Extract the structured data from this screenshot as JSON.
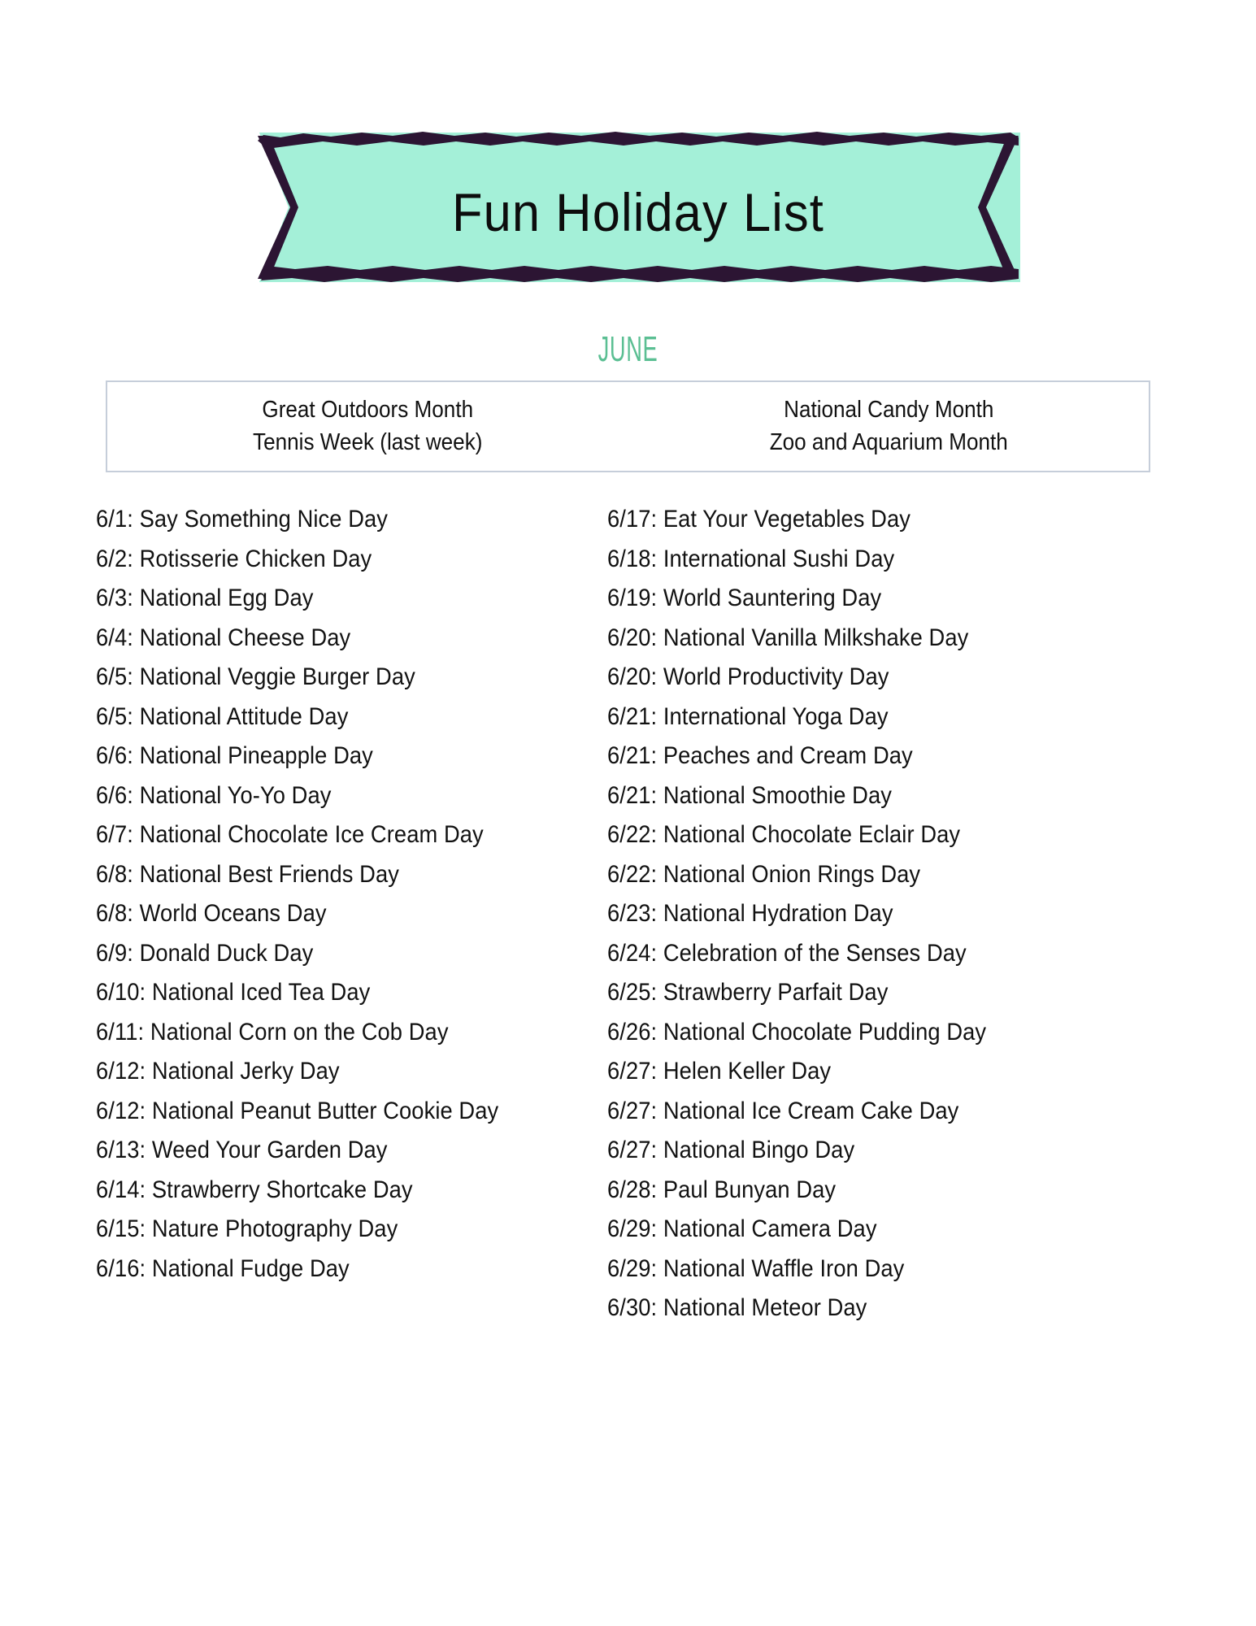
{
  "colors": {
    "banner_fill": "#a4f0d8",
    "banner_outline": "#2c1533",
    "month_accent": "#5bbf93",
    "box_border": "#c6ceda",
    "text": "#121212",
    "page_background": "#ffffff"
  },
  "header": {
    "title": "Fun Holiday List",
    "month": "JUNE"
  },
  "observances": {
    "left": [
      "Great Outdoors Month",
      "Tennis Week (last week)"
    ],
    "right": [
      "National Candy Month",
      "Zoo and Aquarium Month"
    ]
  },
  "holidays": {
    "left_column": [
      "6/1: Say Something Nice Day",
      "6/2: Rotisserie Chicken Day",
      "6/3: National Egg Day",
      "6/4: National Cheese Day",
      "6/5: National Veggie Burger Day",
      "6/5: National Attitude Day",
      "6/6: National Pineapple Day",
      "6/6: National Yo-Yo Day",
      "6/7: National Chocolate Ice Cream Day",
      "6/8: National Best Friends Day",
      "6/8: World Oceans Day",
      "6/9: Donald Duck Day",
      "6/10: National Iced Tea Day",
      "6/11: National Corn on the Cob Day",
      "6/12: National Jerky Day",
      "6/12: National Peanut Butter Cookie Day",
      "6/13: Weed Your Garden Day",
      "6/14: Strawberry Shortcake Day",
      "6/15: Nature Photography Day",
      "6/16: National Fudge Day"
    ],
    "right_column": [
      "6/17: Eat Your Vegetables Day",
      "6/18: International Sushi Day",
      "6/19: World Sauntering Day",
      "6/20: National Vanilla Milkshake Day",
      "6/20: World Productivity Day",
      "6/21: International Yoga Day",
      "6/21: Peaches and Cream Day",
      "6/21: National Smoothie Day",
      "6/22: National Chocolate Eclair Day",
      "6/22: National Onion Rings Day",
      "6/23: National Hydration Day",
      "6/24: Celebration of the Senses Day",
      "6/25: Strawberry Parfait Day",
      "6/26: National Chocolate Pudding Day",
      "6/27: Helen Keller Day",
      "6/27: National Ice Cream Cake Day",
      "6/27: National Bingo Day",
      "6/28: Paul Bunyan Day",
      "6/29: National Camera Day",
      "6/29: National Waffle Iron Day",
      "6/30: National Meteor Day"
    ]
  }
}
